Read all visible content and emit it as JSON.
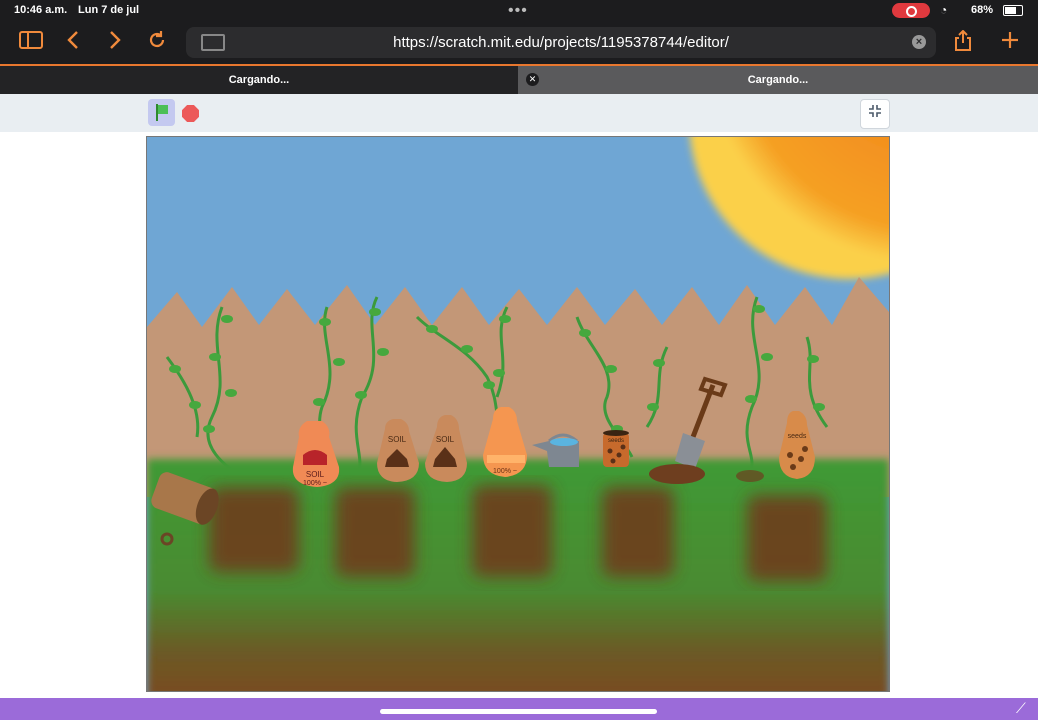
{
  "status_bar": {
    "time": "10:46 a.m.",
    "date": "Lun 7 de jul",
    "battery": "68%"
  },
  "browser": {
    "url": "https://scratch.mit.edu/projects/1195378744/editor/",
    "tabs": [
      {
        "label": "Cargando..."
      },
      {
        "label": "Cargando..."
      }
    ]
  },
  "stage": {
    "bag_labels": {
      "bag1_top": "SOIL",
      "bag1_bottom": "100% ~",
      "bag2": "SOIL",
      "bag3": "SOIL",
      "bag4": "100% ~",
      "can": "seeds",
      "bag5": "seeds"
    }
  },
  "colors": {
    "accent": "#f08a3c",
    "scratch_purple": "#9b6bd9",
    "sky": "#6fa6d4",
    "fence": "#c39777",
    "grass": "#3f9a35",
    "soil": "#6e3e1f"
  }
}
